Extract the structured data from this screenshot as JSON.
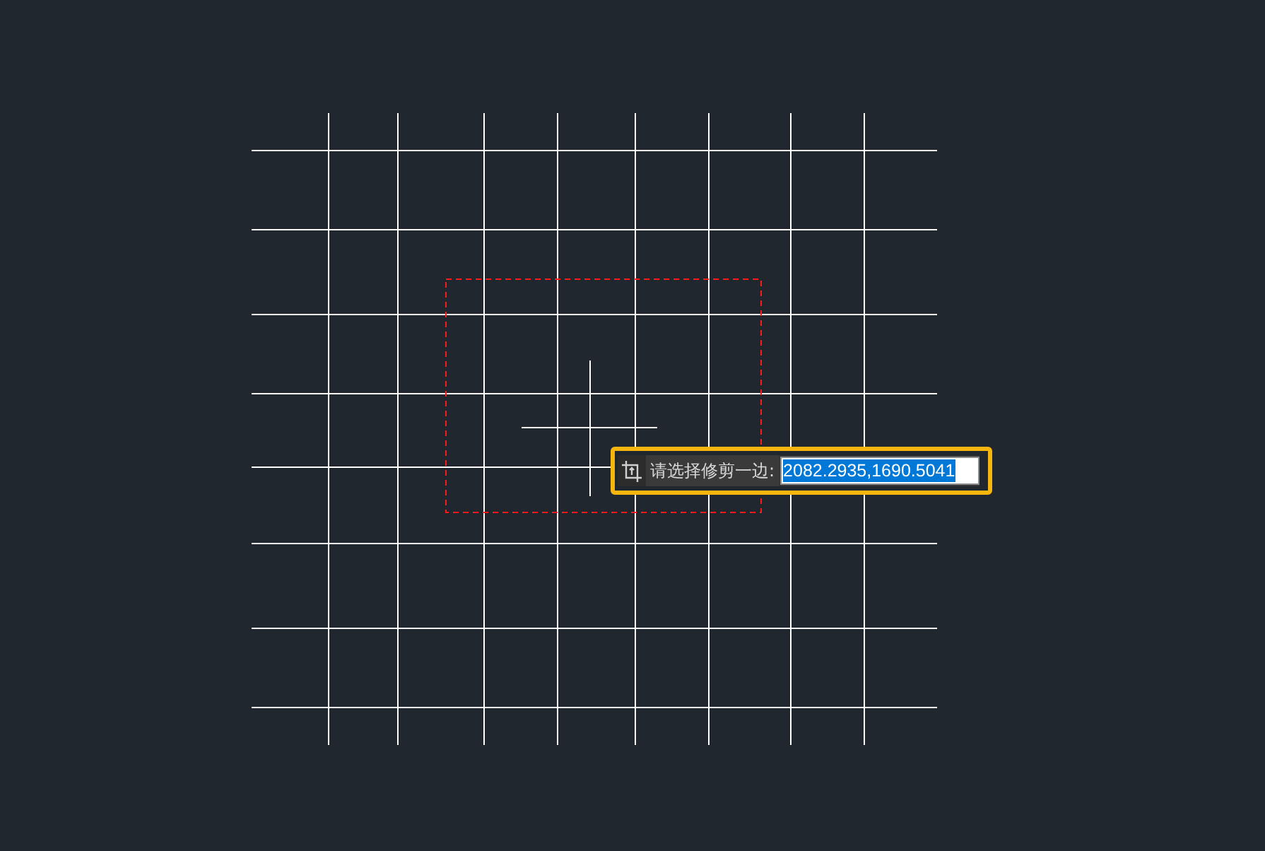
{
  "command_prompt": {
    "label": "请选择修剪一边:",
    "value": "2082.2935,1690.5041",
    "selected": true
  }
}
